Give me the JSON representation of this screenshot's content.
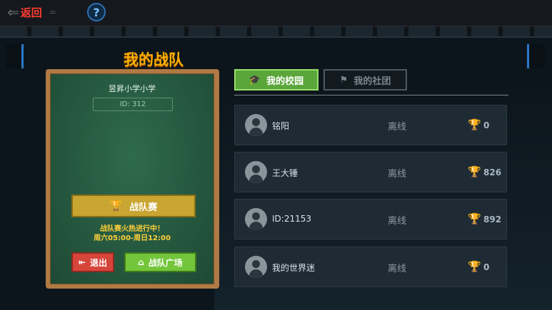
{
  "header": {
    "back_arrow": "⇐",
    "back_label": "返回",
    "eq_mark": "=",
    "help_label": "?"
  },
  "board": {
    "title": "我的战队",
    "school_name": "昱昇小学小学",
    "team_id": "ID: 312",
    "match_button": "战队赛",
    "notice_line1": "战队赛火热进行中！",
    "notice_line2": "周六05:00-周日12:00",
    "exit_button": "退出",
    "plaza_button": "战队广场"
  },
  "tabs": [
    {
      "label": "我的校园",
      "active": true,
      "icon": "graduation-cap-icon"
    },
    {
      "label": "我的社团",
      "active": false,
      "icon": "flag-icon"
    }
  ],
  "members": [
    {
      "name": "铭阳",
      "status": "离线",
      "score": "0"
    },
    {
      "name": "王大锤",
      "status": "离线",
      "score": "826"
    },
    {
      "name": "ID:21153",
      "status": "离线",
      "score": "892"
    },
    {
      "name": "我的世界迷",
      "status": "离线",
      "score": "0"
    }
  ],
  "colors": {
    "accent_green": "#5aa63a",
    "title_orange": "#ffb000",
    "back_red": "#ff3b2f",
    "trophy_gold": "#f2b900"
  }
}
